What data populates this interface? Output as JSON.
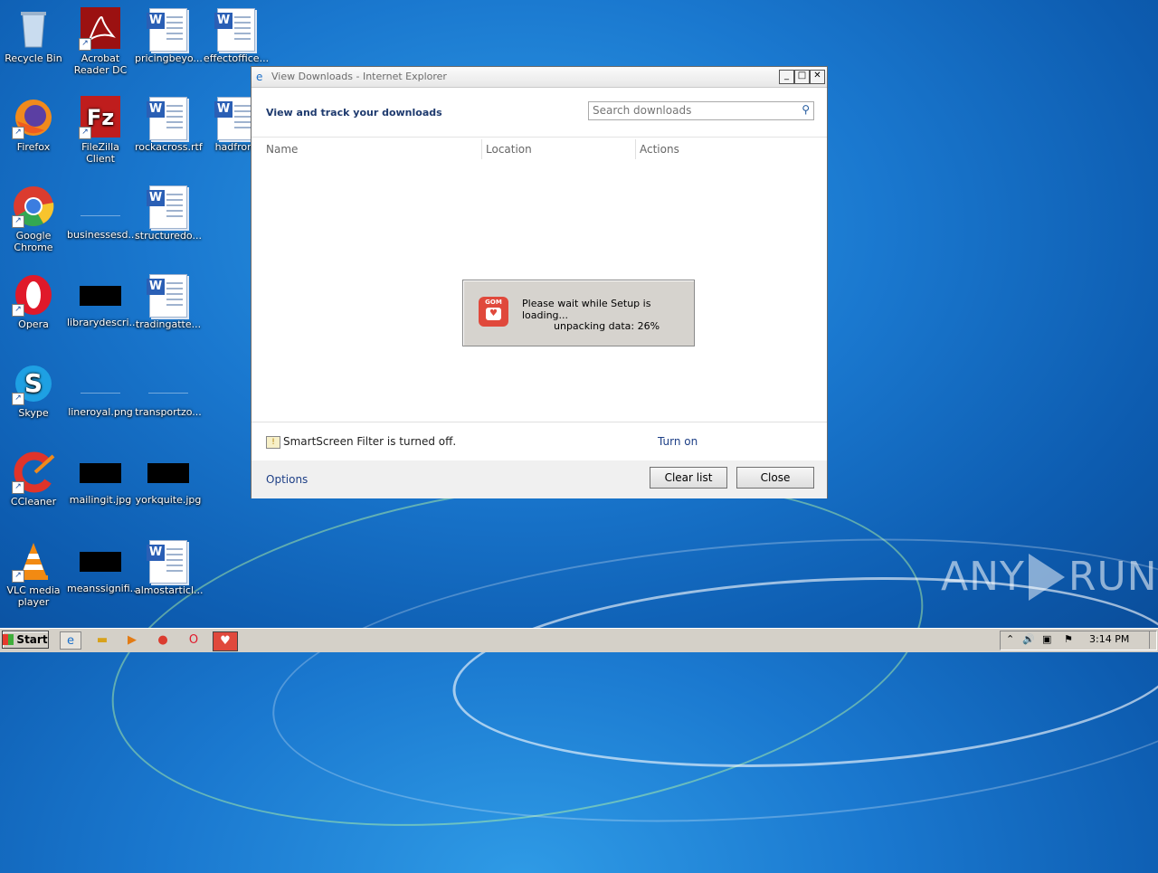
{
  "desktop": {
    "icons": [
      {
        "label": "Recycle Bin"
      },
      {
        "label": "Acrobat Reader DC"
      },
      {
        "label": "pricingbeyo..."
      },
      {
        "label": "effectoffice..."
      },
      {
        "label": "Firefox"
      },
      {
        "label": "FileZilla Client"
      },
      {
        "label": "rockacross.rtf"
      },
      {
        "label": "hadfront"
      },
      {
        "label": "Google Chrome"
      },
      {
        "label": "businessesd..."
      },
      {
        "label": "structuredo..."
      },
      {
        "label": "Opera"
      },
      {
        "label": "librarydescri..."
      },
      {
        "label": "tradingatte..."
      },
      {
        "label": "Skype"
      },
      {
        "label": "lineroyal.png"
      },
      {
        "label": "transportzo..."
      },
      {
        "label": "CCleaner"
      },
      {
        "label": "mailingit.jpg"
      },
      {
        "label": "yorkquite.jpg"
      },
      {
        "label": "VLC media player"
      },
      {
        "label": "meanssignifi..."
      },
      {
        "label": "almostarticl..."
      }
    ]
  },
  "window": {
    "title": "View Downloads - Internet Explorer",
    "heading": "View and track your downloads",
    "search_placeholder": "Search downloads",
    "columns": {
      "name": "Name",
      "location": "Location",
      "actions": "Actions"
    },
    "smartscreen_text": "SmartScreen Filter is turned off.",
    "turn_on": "Turn on",
    "options": "Options",
    "clear_list": "Clear list",
    "close": "Close"
  },
  "setup_popup": {
    "logo_text": "GOM",
    "message": "Please wait while Setup is loading...",
    "progress_text": "unpacking data: 26%",
    "progress": 0.26
  },
  "taskbar": {
    "start_label": "Start",
    "clock": "3:14 PM"
  },
  "watermark": {
    "left": "ANY",
    "right": "RUN"
  }
}
